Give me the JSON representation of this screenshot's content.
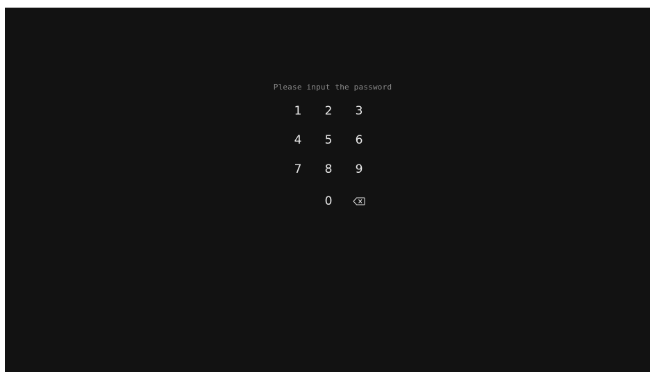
{
  "lock_screen": {
    "prompt": "Please input the password",
    "keypad": {
      "keys": [
        "1",
        "2",
        "3",
        "4",
        "5",
        "6",
        "7",
        "8",
        "9",
        "0"
      ],
      "backspace_icon": "backspace-icon"
    }
  },
  "colors": {
    "background": "#121212",
    "prompt_text": "#8a8a8a",
    "key_text": "#e8e8e8"
  }
}
